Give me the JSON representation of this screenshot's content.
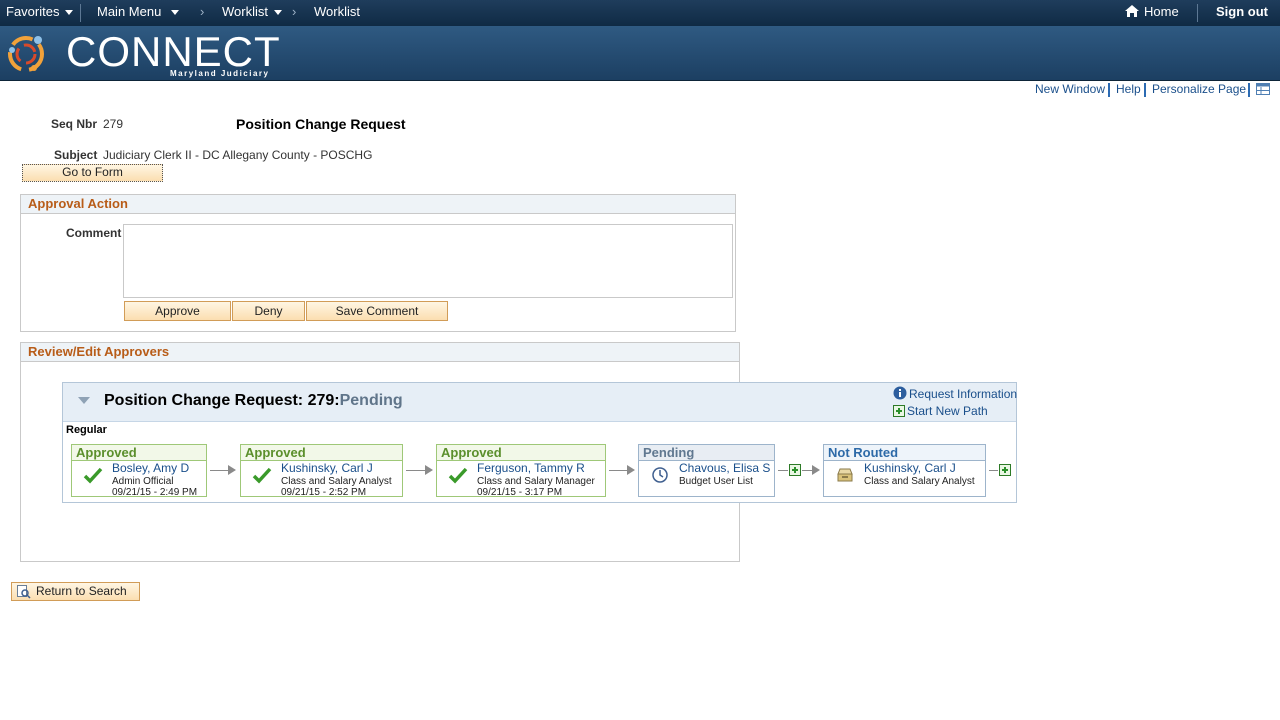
{
  "topnav": {
    "favorites": "Favorites",
    "main_menu": "Main Menu",
    "breadcrumbs": [
      "Worklist",
      "Worklist"
    ],
    "home": "Home",
    "sign_out": "Sign out"
  },
  "brand": {
    "name": "CONNECT",
    "subtitle": "Maryland Judiciary"
  },
  "utility_links": {
    "new_window": "New Window",
    "help": "Help",
    "personalize": "Personalize Page"
  },
  "header": {
    "seq_label": "Seq Nbr",
    "seq_value": "279",
    "title": "Position Change Request",
    "subject_label": "Subject",
    "subject_value": "Judiciary Clerk II - DC Allegany County - POSCHG",
    "go_to_form": "Go to Form"
  },
  "approval_action": {
    "title": "Approval Action",
    "comment_label": "Comment",
    "comment_value": "",
    "approve": "Approve",
    "deny": "Deny",
    "save_comment": "Save Comment"
  },
  "review": {
    "title": "Review/Edit Approvers",
    "flow_title": "Position Change Request: 279:",
    "flow_status": "Pending",
    "request_info": "Request Information",
    "start_new_path": "Start New Path",
    "path_name": "Regular",
    "steps": [
      {
        "status": "Approved",
        "name": "Bosley, Amy D",
        "role": "Admin Official",
        "date": "09/21/15 - 2:49 PM"
      },
      {
        "status": "Approved",
        "name": "Kushinsky, Carl J",
        "role": "Class and Salary Analyst",
        "date": "09/21/15 - 2:52 PM"
      },
      {
        "status": "Approved",
        "name": "Ferguson, Tammy R",
        "role": "Class and Salary Manager",
        "date": "09/21/15 - 3:17 PM"
      },
      {
        "status": "Pending",
        "name": "Chavous, Elisa S",
        "role": "Budget User List",
        "date": ""
      },
      {
        "status": "Not Routed",
        "name": "Kushinsky, Carl J",
        "role": "Class and Salary Analyst",
        "date": ""
      }
    ]
  },
  "return_to_search": "Return to Search",
  "colors": {
    "nav_bg": "#0f2a44",
    "section_title": "#b85c18",
    "link": "#1a4f8b",
    "approved": "#5b8f2c",
    "button_bg": "#fbdeb0"
  }
}
